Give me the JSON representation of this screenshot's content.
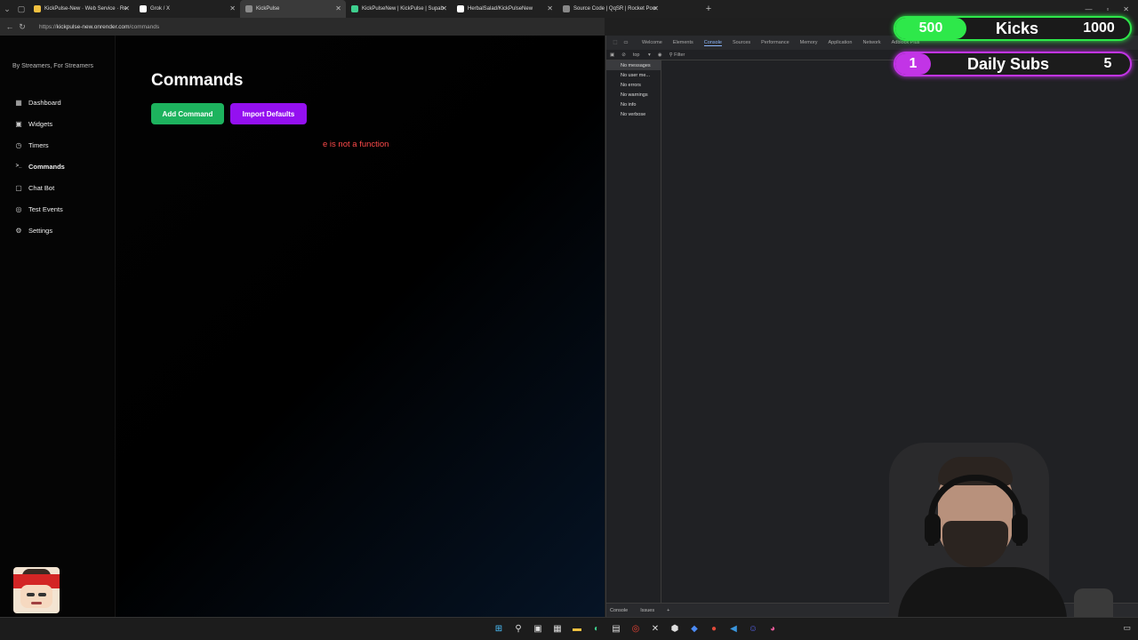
{
  "browser": {
    "tabs": [
      {
        "title": "KickPulse-New · Web Service · Re",
        "active": false,
        "color": "#f0c040"
      },
      {
        "title": "Grok / X",
        "active": false,
        "color": "#ffffff"
      },
      {
        "title": "KickPulse",
        "active": true,
        "color": "#8a8a8a"
      },
      {
        "title": "KickPulseNew | KickPulse | Supab",
        "active": false,
        "color": "#3ecf8e"
      },
      {
        "title": "HerbalSalad/KickPulseNew",
        "active": false,
        "color": "#ffffff"
      },
      {
        "title": "Source Code | QqSR | Rocket Pow",
        "active": false,
        "color": "#888888"
      }
    ],
    "url_scheme": "https://",
    "url_host": "kickpulse-new.onrender.com",
    "url_path": "/commands"
  },
  "app": {
    "tagline": "By Streamers, For Streamers",
    "nav": [
      {
        "label": "Dashboard",
        "icon": "dashboard-icon"
      },
      {
        "label": "Widgets",
        "icon": "widgets-icon"
      },
      {
        "label": "Timers",
        "icon": "clock-icon"
      },
      {
        "label": "Commands",
        "icon": "terminal-icon",
        "active": true
      },
      {
        "label": "Chat Bot",
        "icon": "chat-icon"
      },
      {
        "label": "Test Events",
        "icon": "test-icon"
      },
      {
        "label": "Settings",
        "icon": "gear-icon"
      }
    ],
    "page_title": "Commands",
    "add_button": "Add Command",
    "import_button": "Import Defaults",
    "error": "e is not a function",
    "accent_green": "#1db35e",
    "accent_purple": "#9410f0"
  },
  "devtools": {
    "tabs": [
      "Welcome",
      "Elements",
      "Console",
      "Sources",
      "Performance",
      "Memory",
      "Application",
      "Network",
      "Adblock Plus"
    ],
    "active_tab": "Console",
    "context": "top",
    "filter_placeholder": "Filter",
    "filters": [
      "No messages",
      "No user me...",
      "No errors",
      "No warnings",
      "No info",
      "No verbose"
    ],
    "bottom_tabs": [
      "Console",
      "Issues"
    ]
  },
  "overlay": {
    "kicks_current": "500",
    "kicks_label": "Kicks",
    "kicks_goal": "1000",
    "subs_current": "1",
    "subs_label": "Daily Subs",
    "subs_goal": "5",
    "kicks_color": "#2ee84a",
    "subs_color": "#c234e6"
  }
}
